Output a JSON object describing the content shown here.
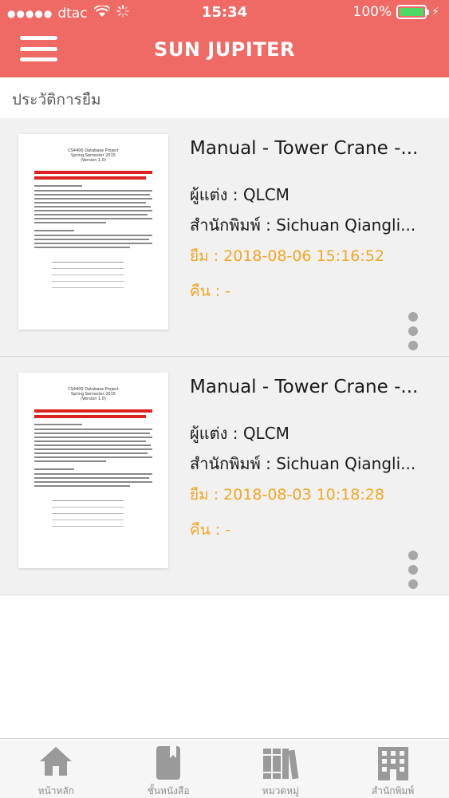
{
  "status_bar": {
    "carrier": "dtac",
    "time": "15:34",
    "battery": "100%"
  },
  "header": {
    "title": "SUN JUPITER"
  },
  "section": {
    "title": "ประวัติการยืม"
  },
  "history": [
    {
      "title": "Manual - Tower Crane -...",
      "author": "ผู้แต่ง : QLCM",
      "publisher": "สำนักพิมพ์ : Sichuan Qiangli...",
      "borrowed": "ยืม : 2018-08-06 15:16:52",
      "returned": "คืน : -",
      "thumb": {
        "heading": "CS4400 Database Project",
        "subheading": "Spring Semester 2015",
        "version": "(Version 1.0)"
      }
    },
    {
      "title": "Manual - Tower Crane -...",
      "author": "ผู้แต่ง : QLCM",
      "publisher": "สำนักพิมพ์ : Sichuan Qiangli...",
      "borrowed": "ยืม : 2018-08-03 10:18:28",
      "returned": "คืน : -",
      "thumb": {
        "heading": "CS4400 Database Project",
        "subheading": "Spring Semester 2015",
        "version": "(Version 1.0)"
      }
    }
  ],
  "tabs": [
    {
      "label": "หน้าหลัก",
      "icon": "home-icon"
    },
    {
      "label": "ชั้นหนังสือ",
      "icon": "bookshelf-icon"
    },
    {
      "label": "หมวดหมู่",
      "icon": "category-books-icon"
    },
    {
      "label": "สำนักพิมพ์",
      "icon": "publisher-building-icon"
    }
  ],
  "colors": {
    "header": "#ef6a64",
    "accent_orange": "#f3a623",
    "list_background": "#f1f1f1",
    "tab_icon": "#9a9a9a"
  }
}
